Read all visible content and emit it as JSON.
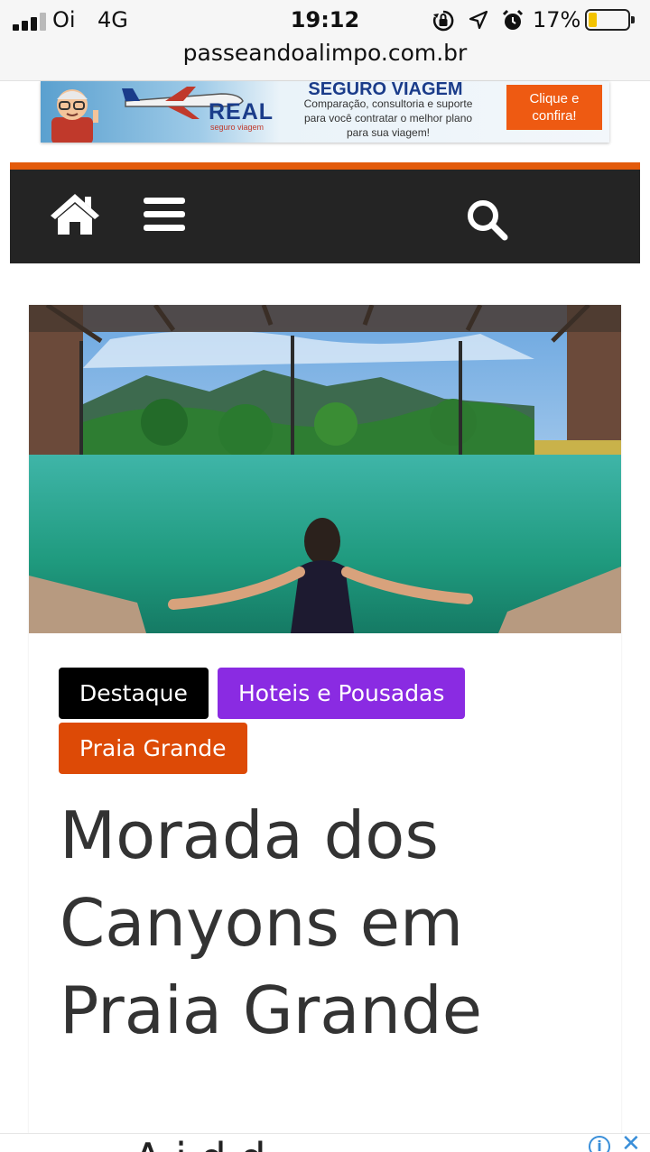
{
  "status_bar": {
    "carrier": "Oi",
    "network": "4G",
    "time": "19:12",
    "battery_percent": "17%",
    "battery_level": 0.17,
    "icons": [
      "signal-icon",
      "orientation-lock-icon",
      "location-arrow-icon",
      "alarm-icon",
      "battery-icon"
    ]
  },
  "browser": {
    "url": "passeandoalimpo.com.br"
  },
  "ad_banner": {
    "brand": "REAL",
    "brand_sub": "seguro viagem",
    "headline": "SEGURO VIAGEM",
    "body": "Comparação, consultoria e suporte para você contratar o melhor plano para sua viagem!",
    "cta": "Clique e confira!",
    "colors": {
      "cta": "#ee5a12",
      "brand": "#1a3c8a"
    }
  },
  "nav": {
    "accent_color": "#e35b0c",
    "background": "#242424",
    "icons": [
      "home-icon",
      "menu-icon",
      "search-icon"
    ]
  },
  "article": {
    "tags": [
      {
        "label": "Destaque",
        "color": "#000000"
      },
      {
        "label": "Hoteis e Pousadas",
        "color": "#8a2be2"
      },
      {
        "label": "Praia Grande",
        "color": "#dd4a06"
      }
    ],
    "title": "Morada dos Canyons em Praia Grande"
  },
  "bottom_ad": {
    "text": "A i      d                 d"
  }
}
